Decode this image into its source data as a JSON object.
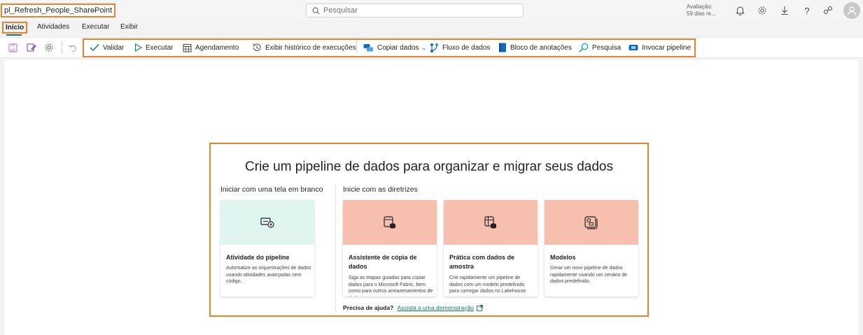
{
  "app": {
    "title": "pl_Refresh_People_SharePoint",
    "search_placeholder": "Pesquisar",
    "trial_line1": "Avaliação:",
    "trial_line2": "59 dias re..."
  },
  "tabs": [
    {
      "label": "Início"
    },
    {
      "label": "Atividades"
    },
    {
      "label": "Executar"
    },
    {
      "label": "Exibir"
    }
  ],
  "toolbar": {
    "validate": "Validar",
    "run": "Executar",
    "schedule": "Agendamento",
    "history": "Exibir histórico de execuções",
    "copy_data": "Copiar dados",
    "dataflow": "Fluxo de dados",
    "notebook": "Bloco de anotações",
    "search": "Pesquisa",
    "invoke": "Invocar pipeline"
  },
  "main": {
    "headline": "Crie um pipeline de dados para organizar e migrar seus dados",
    "blank_label": "Iniciar com uma tela em branco",
    "guided_label": "Inicie com as diretrizes",
    "cards": [
      {
        "title": "Atividade do pipeline",
        "desc": "Automatize as orquestrações de dados usando atividades avançadas sem código."
      },
      {
        "title": "Assistente de cópia de dados",
        "desc": "Siga as etapas guiadas para copiar dados para o Microsoft Fabric, bem como para outros armazenamentos de dados."
      },
      {
        "title": "Prática com dados de amostra",
        "desc": "Crie rapidamente um pipeline de dados com um modelo predefinido para carregar dados no Lakehouse."
      },
      {
        "title": "Modelos",
        "desc": "Gerar um novo pipeline de dados rapidamente usando um cenário de dados predefinido."
      }
    ],
    "help_label": "Precisa de ajuda?",
    "help_link": "Assista a uma demonstração"
  },
  "colors": {
    "accent": "#117865",
    "highlight": "#e8822c",
    "card_mint": "#e0f5ef",
    "card_salmon": "#f7bfae"
  }
}
